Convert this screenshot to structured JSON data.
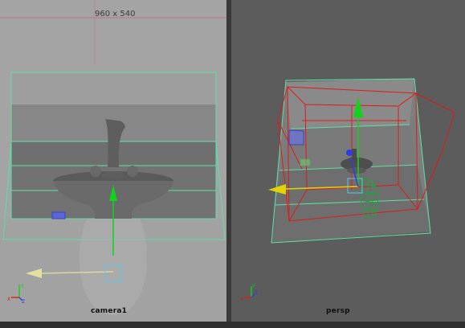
{
  "left_viewport": {
    "camera_name": "camera1",
    "resolution": "960 x 540"
  },
  "right_viewport": {
    "camera_name": "persp"
  },
  "icons": {
    "axis_left": "axis-gizmo-icon",
    "axis_right": "axis-gizmo-icon",
    "move_manip": "move-manipulator-icon"
  },
  "colors": {
    "wire_green": "#5be0a6",
    "wire_red": "#e01a1a",
    "manip_green": "#12d21c",
    "manip_yellow": "#e2d400",
    "manip_blue": "#2a3ee6"
  }
}
